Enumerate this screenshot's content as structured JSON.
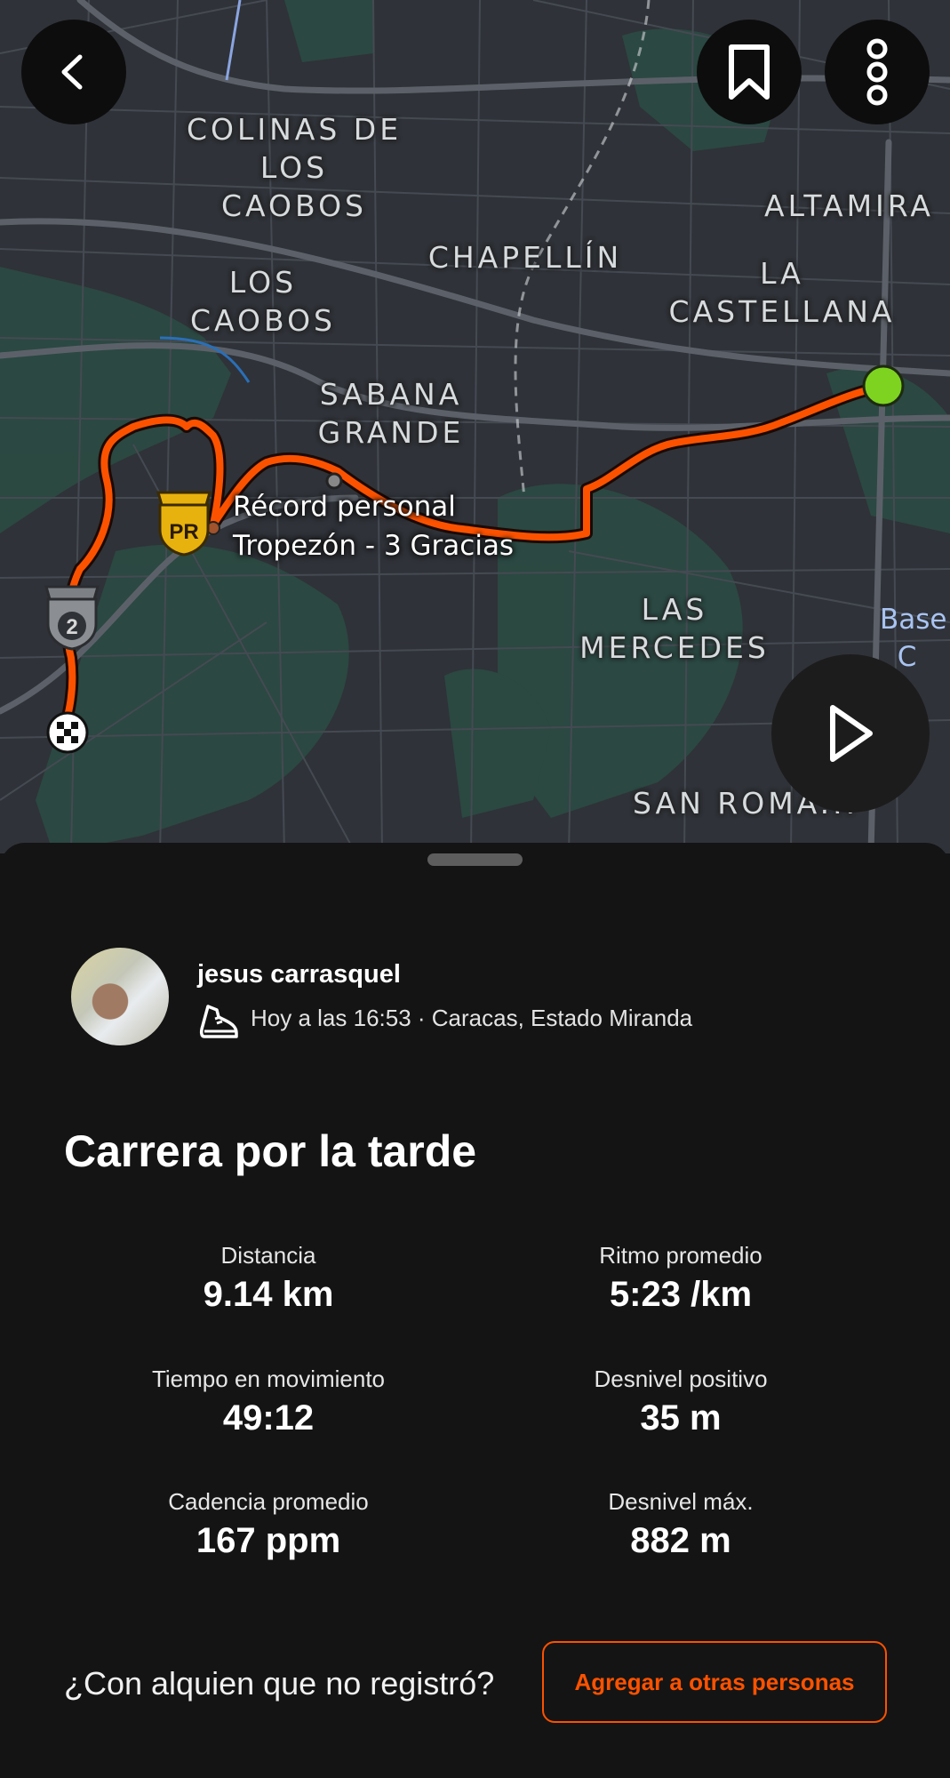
{
  "map": {
    "labels": [
      {
        "id": "colinas",
        "text": "COLINAS DE\nLOS\nCAOBOS"
      },
      {
        "id": "chapellin",
        "text": "CHAPELLÍN"
      },
      {
        "id": "altamira",
        "text": "ALTAMIRA"
      },
      {
        "id": "loscaobos",
        "text": "LOS\nCAOBOS"
      },
      {
        "id": "lacastellana",
        "text": "LA\nCASTELLANA"
      },
      {
        "id": "sabana",
        "text": "SABANA\nGRANDE"
      },
      {
        "id": "lasmercedes",
        "text": "LAS\nMERCEDES"
      },
      {
        "id": "sanroman",
        "text": "SAN ROMA..."
      }
    ],
    "pr_badge": "PR",
    "medal_rank": "2",
    "pr_label_line1": "Récord personal",
    "pr_label_line2": "Tropezón - 3 Gracias",
    "edge_label": "Base\n  C",
    "route_color": "#fc5200",
    "start_color": "#7ed321",
    "icons": {
      "back": "chevron-left-icon",
      "bookmark": "bookmark-icon",
      "more": "more-vertical-icon",
      "play": "play-icon",
      "finish": "checkered-flag-icon"
    }
  },
  "activity": {
    "athlete_name": "jesus carrasquel",
    "meta": "Hoy a las 16:53 · Caracas, Estado Miranda",
    "sport_icon": "running-shoe-icon",
    "title": "Carrera por la tarde",
    "stats": [
      {
        "label": "Distancia",
        "value": "9.14 km"
      },
      {
        "label": "Ritmo promedio",
        "value": "5:23 /km"
      },
      {
        "label": "Tiempo en movimiento",
        "value": "49:12"
      },
      {
        "label": "Desnivel positivo",
        "value": "35 m"
      },
      {
        "label": "Cadencia promedio",
        "value": "167 ppm"
      },
      {
        "label": "Desnivel máx.",
        "value": "882 m"
      }
    ]
  },
  "footer": {
    "question": "¿Con alquien que no registró?",
    "add_button": "Agregar a otras personas"
  }
}
